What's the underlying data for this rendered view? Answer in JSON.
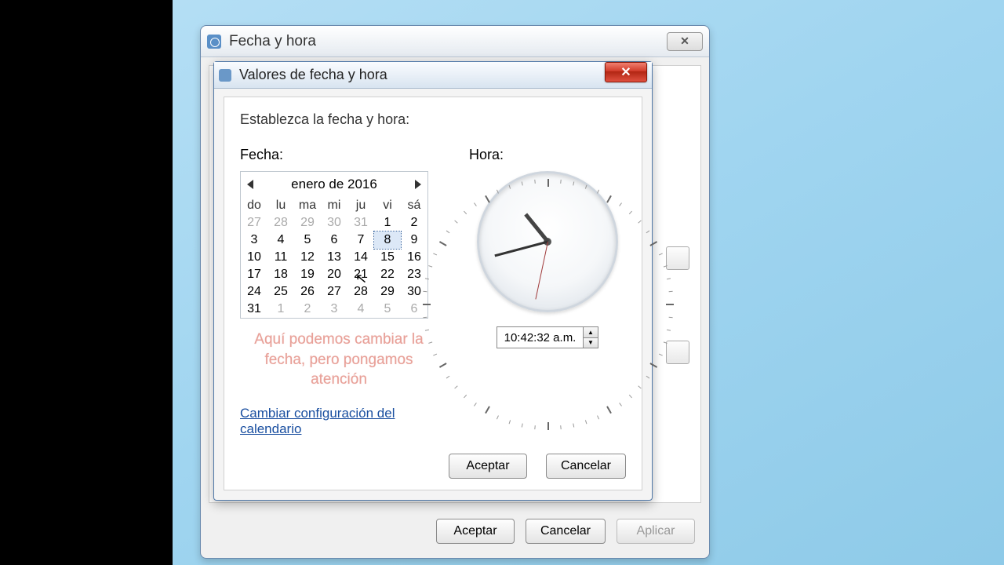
{
  "parent": {
    "title": "Fecha y hora",
    "buttons": {
      "ok": "Aceptar",
      "cancel": "Cancelar",
      "apply": "Aplicar"
    }
  },
  "child": {
    "title": "Valores de fecha y hora",
    "instruction": "Establezca la fecha y hora:",
    "date_label": "Fecha:",
    "time_label": "Hora:",
    "month": "enero de 2016",
    "weekdays": [
      "do",
      "lu",
      "ma",
      "mi",
      "ju",
      "vi",
      "sá"
    ],
    "grid": [
      [
        {
          "d": "27",
          "o": true
        },
        {
          "d": "28",
          "o": true
        },
        {
          "d": "29",
          "o": true
        },
        {
          "d": "30",
          "o": true
        },
        {
          "d": "31",
          "o": true
        },
        {
          "d": "1"
        },
        {
          "d": "2"
        }
      ],
      [
        {
          "d": "3"
        },
        {
          "d": "4"
        },
        {
          "d": "5"
        },
        {
          "d": "6"
        },
        {
          "d": "7"
        },
        {
          "d": "8",
          "sel": true
        },
        {
          "d": "9"
        }
      ],
      [
        {
          "d": "10"
        },
        {
          "d": "11"
        },
        {
          "d": "12"
        },
        {
          "d": "13"
        },
        {
          "d": "14"
        },
        {
          "d": "15"
        },
        {
          "d": "16"
        }
      ],
      [
        {
          "d": "17"
        },
        {
          "d": "18"
        },
        {
          "d": "19"
        },
        {
          "d": "20"
        },
        {
          "d": "21"
        },
        {
          "d": "22"
        },
        {
          "d": "23"
        }
      ],
      [
        {
          "d": "24"
        },
        {
          "d": "25"
        },
        {
          "d": "26"
        },
        {
          "d": "27"
        },
        {
          "d": "28"
        },
        {
          "d": "29"
        },
        {
          "d": "30"
        }
      ],
      [
        {
          "d": "31"
        },
        {
          "d": "1",
          "o": true
        },
        {
          "d": "2",
          "o": true
        },
        {
          "d": "3",
          "o": true
        },
        {
          "d": "4",
          "o": true
        },
        {
          "d": "5",
          "o": true
        },
        {
          "d": "6",
          "o": true
        }
      ]
    ],
    "time_value": "10:42:32 a.m.",
    "clock": {
      "hour": 10,
      "minute": 42,
      "second": 32
    },
    "annotation": "Aquí podemos cambiar la fecha, pero pongamos atención",
    "link": "Cambiar configuración del calendario",
    "buttons": {
      "ok": "Aceptar",
      "cancel": "Cancelar"
    }
  }
}
